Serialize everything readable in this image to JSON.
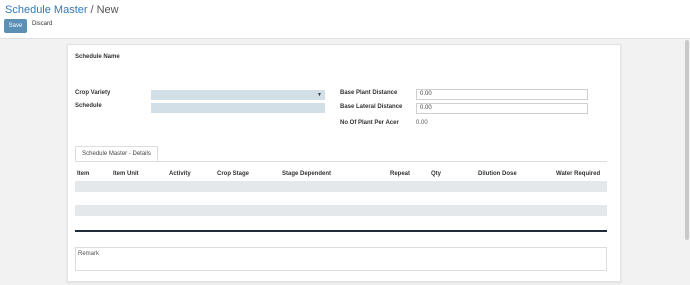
{
  "breadcrumb": {
    "parent": "Schedule Master",
    "separator": "/",
    "current": "New"
  },
  "toolbar": {
    "save_label": "Save",
    "discard_label": "Discard"
  },
  "form": {
    "schedule_name_label": "Schedule Name",
    "crop_variety_label": "Crop Variety",
    "schedule_label": "Schedule",
    "base_plant_distance_label": "Base Plant Distance",
    "base_plant_distance_value": "0.00",
    "base_lateral_distance_label": "Base Lateral Distance",
    "base_lateral_distance_value": "0.00",
    "no_of_plant_label": "No Of Plant Per Acer",
    "no_of_plant_value": "0.00"
  },
  "tabs": [
    {
      "label": "Schedule Master - Details"
    }
  ],
  "table": {
    "columns": [
      "Item",
      "Item Unit",
      "Activity",
      "Crop Stage",
      "Stage Dependent",
      "Repeat",
      "Qty",
      "Dilution Dose",
      "Water Required"
    ]
  },
  "remark": {
    "placeholder": "Remark"
  },
  "colors": {
    "accent": "#5b8fb6",
    "link": "#337ab7",
    "field_bg": "#d3dfe6"
  }
}
